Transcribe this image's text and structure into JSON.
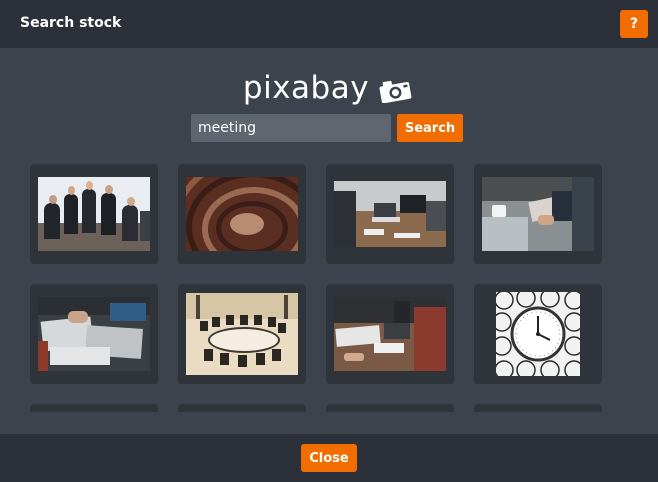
{
  "dialog": {
    "title": "Search stock",
    "help_label": "?",
    "close_label": "Close"
  },
  "logo": {
    "text": "pixabay",
    "icon": "camera-icon"
  },
  "search": {
    "value": "meeting",
    "button_label": "Search"
  },
  "results": [
    {
      "subject": "business team meeting"
    },
    {
      "subject": "auditorium audience"
    },
    {
      "subject": "laptops on meeting table"
    },
    {
      "subject": "hands writing at laptop"
    },
    {
      "subject": "documents on desk"
    },
    {
      "subject": "conference room sketch"
    },
    {
      "subject": "people at meeting desk"
    },
    {
      "subject": "clock pattern"
    },
    {
      "subject": "partial tile"
    },
    {
      "subject": "partial tile"
    },
    {
      "subject": "partial tile"
    },
    {
      "subject": "partial tile selected"
    }
  ],
  "colors": {
    "accent": "#f26d00",
    "header_bg": "#2c3038",
    "body_bg": "#3d434c",
    "tile_bg": "#2f343b",
    "selection": "#2aa3e0"
  }
}
